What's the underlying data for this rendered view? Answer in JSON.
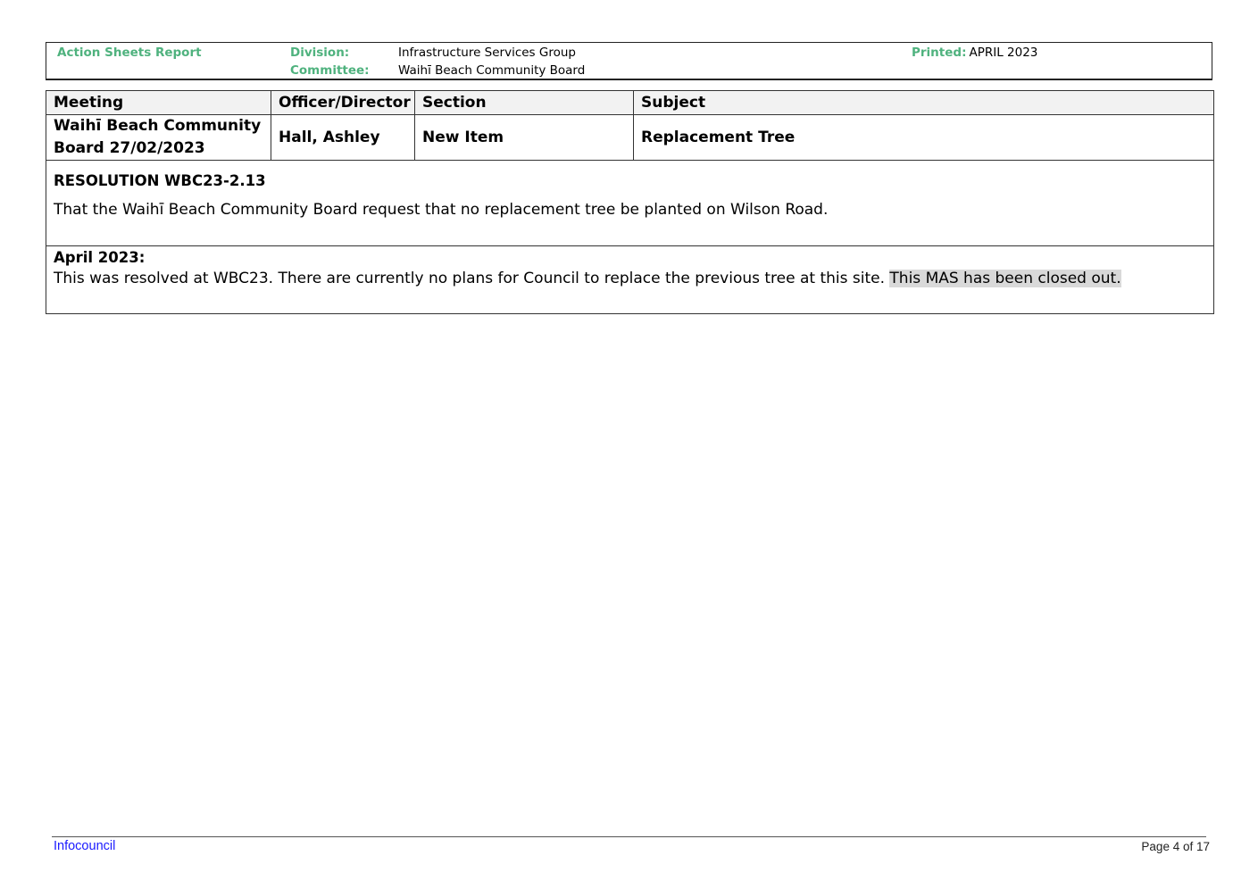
{
  "header": {
    "report_title": "Action Sheets Report",
    "division_label": "Division:",
    "division_value": "Infrastructure Services Group",
    "committee_label": "Committee:",
    "committee_value": "Waihī Beach Community Board",
    "printed_label": "Printed:",
    "printed_value": "APRIL 2023"
  },
  "table": {
    "columns": [
      "Meeting",
      "Officer/Director",
      "Section",
      "Subject"
    ],
    "row": {
      "meeting": "Waihī Beach Community Board 27/02/2023",
      "officer": "Hall, Ashley",
      "section": "New Item",
      "subject": "Replacement Tree"
    },
    "resolution_title": "RESOLUTION WBC23-2.13",
    "resolution_text": "That the Waihī Beach Community Board request that no replacement tree be planted on Wilson Road.",
    "update_title": "April 2023:",
    "update_text": "This was resolved at WBC23. There are currently no plans for Council to replace the previous tree at this site. ",
    "update_highlight": "This MAS has been closed out."
  },
  "footer": {
    "left": "Infocouncil",
    "right": "Page 4 of 17"
  },
  "colors": {
    "label_green": "#4fb27e",
    "footer_link": "#1a1aff",
    "highlight": "#d9d9d9"
  }
}
